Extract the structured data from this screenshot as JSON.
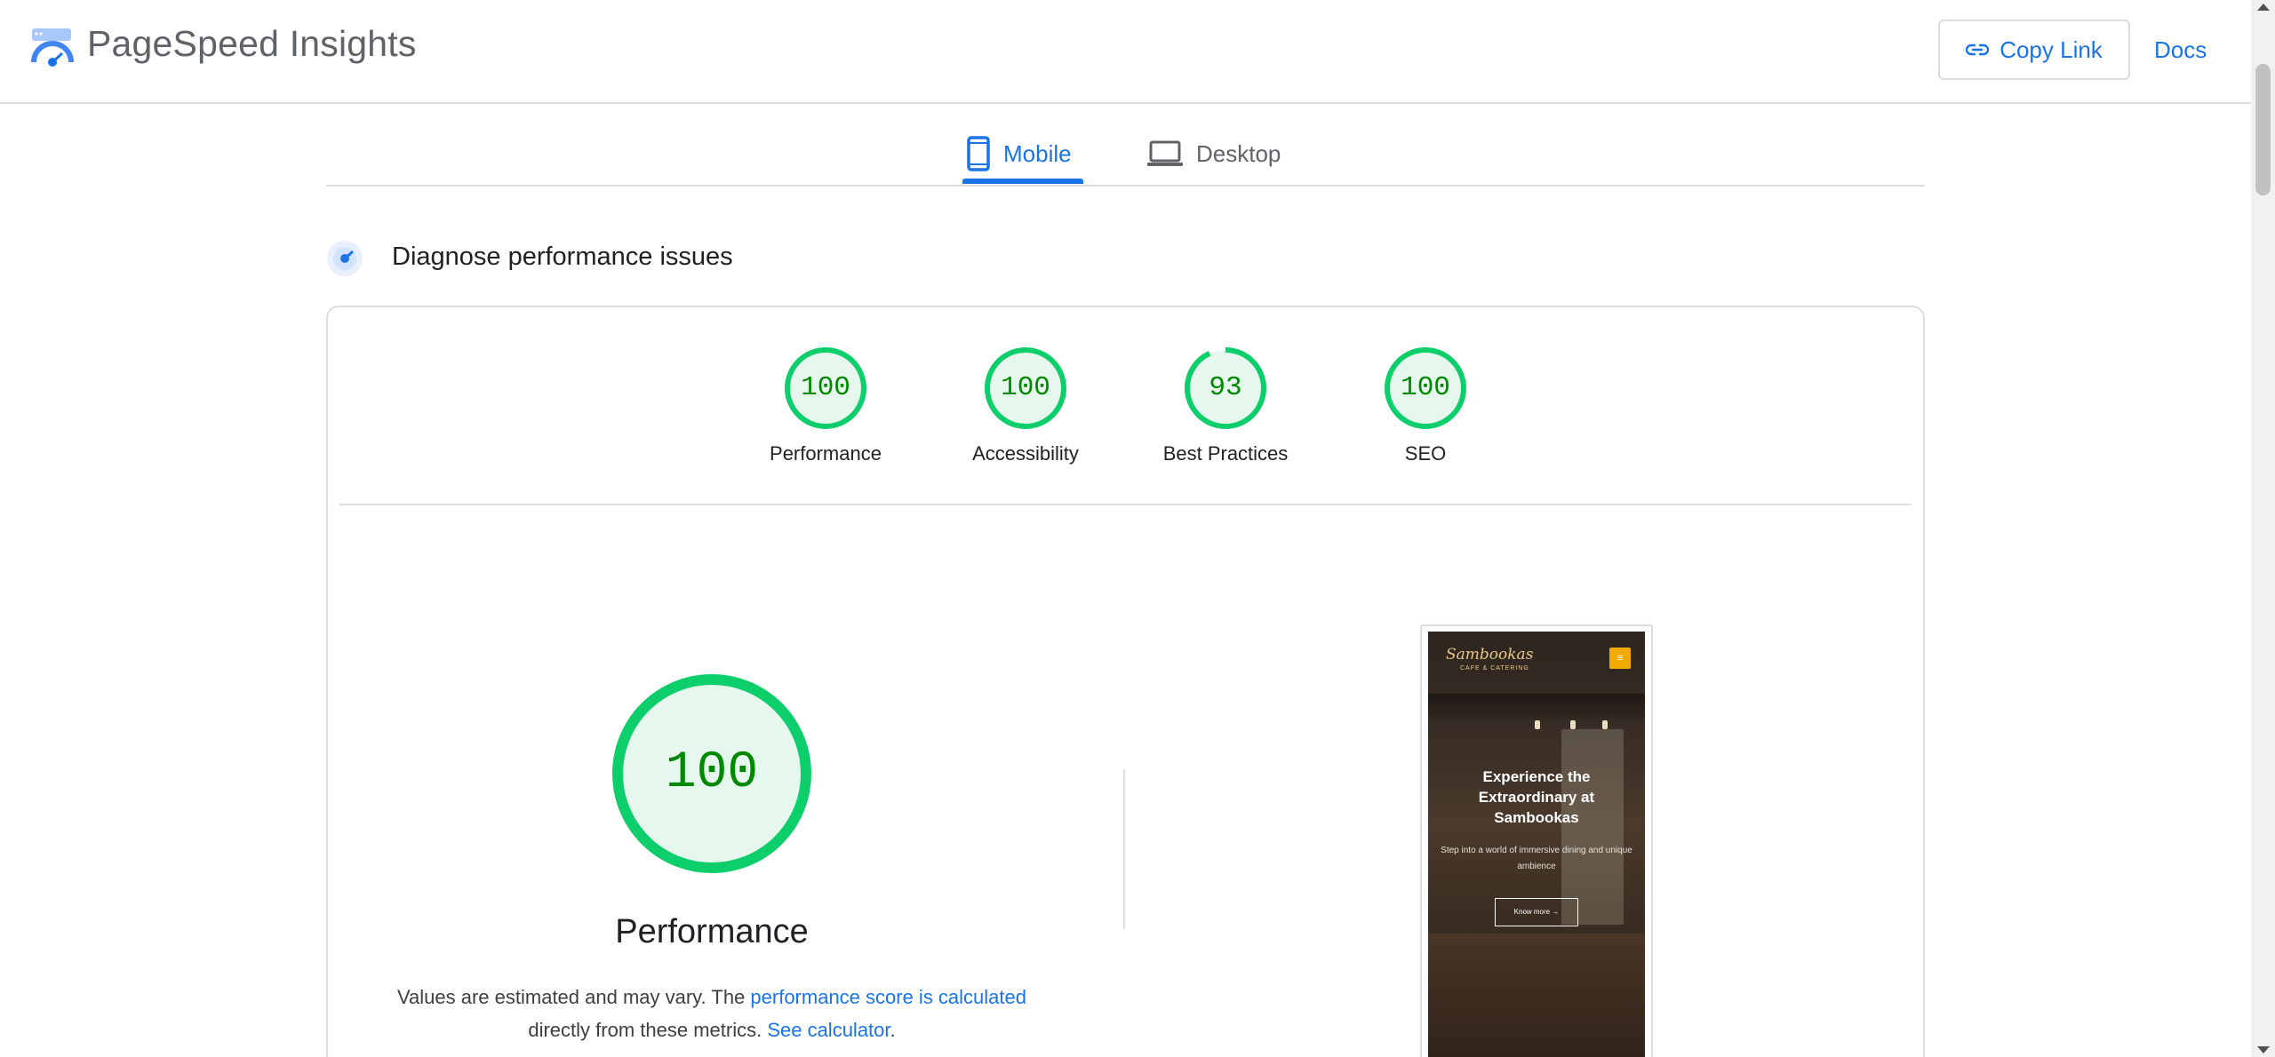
{
  "header": {
    "app_title": "PageSpeed Insights",
    "copy_link_label": "Copy Link",
    "docs_label": "Docs"
  },
  "tabs": [
    {
      "label": "Mobile",
      "icon": "smartphone-icon",
      "selected": true
    },
    {
      "label": "Desktop",
      "icon": "laptop-icon",
      "selected": false
    }
  ],
  "section": {
    "title": "Diagnose performance issues"
  },
  "scores": [
    {
      "label": "Performance",
      "score": "100",
      "fraction": 1.0
    },
    {
      "label": "Accessibility",
      "score": "100",
      "fraction": 1.0
    },
    {
      "label": "Best Practices",
      "score": "93",
      "fraction": 0.93
    },
    {
      "label": "SEO",
      "score": "100",
      "fraction": 1.0
    }
  ],
  "performance": {
    "score": "100",
    "fraction": 1.0,
    "title": "Performance",
    "desc_prefix": "Values are estimated and may vary. The ",
    "desc_link": "performance score is calculated",
    "desc_middle": " directly from these metrics. ",
    "calc_link": "See calculator",
    "desc_suffix": "."
  },
  "screenshot": {
    "logo": "Sambookas",
    "logo_sub": "CAFE & CATERING",
    "menu_icon": "menu-icon",
    "heading": "Experience the Extraordinary at Sambookas",
    "body": "Step into a world of immersive dining and unique ambience",
    "button": "Know more →"
  },
  "colors": {
    "accent": "#1a73e8",
    "pass_green": "#0cce6b",
    "pass_fill": "#e6f8ed",
    "pass_text": "#008800"
  }
}
